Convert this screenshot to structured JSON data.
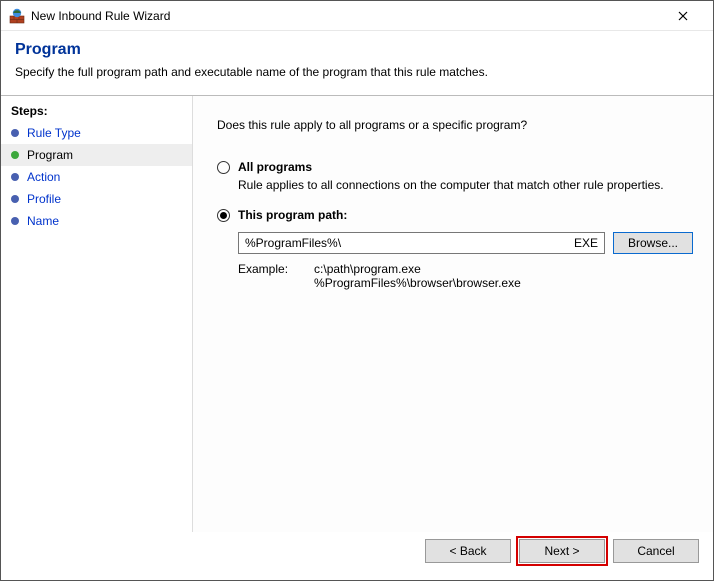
{
  "window": {
    "title": "New Inbound Rule Wizard"
  },
  "header": {
    "title": "Program",
    "subtitle": "Specify the full program path and executable name of the program that this rule matches."
  },
  "sidebar": {
    "heading": "Steps:",
    "items": [
      {
        "label": "Rule Type"
      },
      {
        "label": "Program"
      },
      {
        "label": "Action"
      },
      {
        "label": "Profile"
      },
      {
        "label": "Name"
      }
    ],
    "current_index": 1
  },
  "main": {
    "question": "Does this rule apply to all programs or a specific program?",
    "option_all": {
      "label": "All programs",
      "description": "Rule applies to all connections on the computer that match other rule properties."
    },
    "option_path": {
      "label": "This program path:",
      "value": "%ProgramFiles%\\",
      "extension_hint": "EXE",
      "browse_label": "Browse..."
    },
    "example": {
      "label": "Example:",
      "lines": "c:\\path\\program.exe\n%ProgramFiles%\\browser\\browser.exe"
    }
  },
  "footer": {
    "back": "< Back",
    "next": "Next >",
    "cancel": "Cancel"
  }
}
